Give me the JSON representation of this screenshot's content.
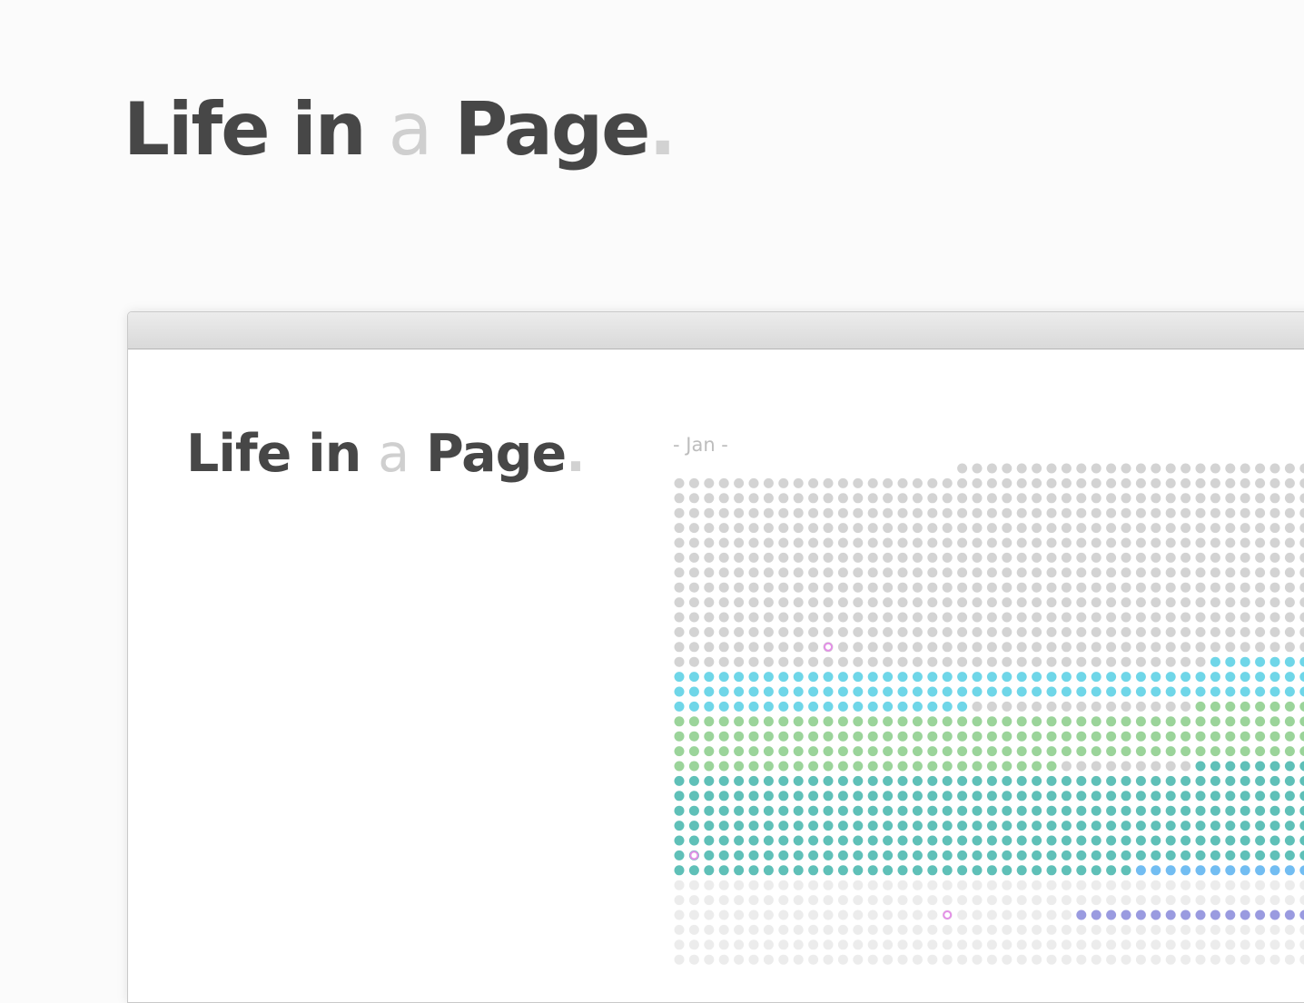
{
  "title": {
    "part1": "Life in",
    "part2": "a",
    "part3": "Page",
    "part4": "."
  },
  "app": {
    "month_label": "- Jan -"
  },
  "colors": {
    "text_dark": "#474747",
    "text_light": "#cfcfcf",
    "dot_gray": "#d3d3d3",
    "dot_lightgray": "#ececec",
    "dot_cyan": "#6fd6e8",
    "dot_green": "#9bd49a",
    "dot_teal": "#5fc0b8",
    "dot_blue": "#72bdf2",
    "dot_purple": "#9a9be0",
    "dot_pink": "#e38fe6"
  },
  "chart_data": {
    "type": "heatmap",
    "month": "Jan",
    "columns": 43,
    "rows": 34,
    "first_day_partial_columns": 19,
    "legend": {
      "g": "gray",
      "c": "cyan",
      "G": "green",
      "t": "teal",
      "b": "blue",
      "p": "purple",
      "l": "lightgray",
      "x": "none"
    },
    "cell_rows": [
      "xxxxxxxxxxxxxxxxxxxggggggggggggggggggggggggg",
      "ggggggggggggggggggggggggggggggggggggggggggg",
      "ggggggggggggggggggggggggggggggggggggggggggg",
      "ggggggggggggggggggggggggggggggggggggggggggg",
      "ggggggggggggggggggggggggggggggggggggggggggg",
      "ggggggggggggggggggggggggggggggggggggggggggg",
      "ggggggggggggggggggggggggggggggggggggggggggg",
      "ggggggggggggggggggggggggggggggggggggggggggg",
      "ggggggggggggggggggggggggggggggggggggggggggg",
      "ggggggggggggggggggggggggggggggggggggggggggg",
      "ggggggggggggggggggggggggggggggggggggggggggg",
      "ggggggggggggggggggggggggggggggggggggggggggg",
      "ggggggggggggggggggggggggggggggggggggggggggg",
      "ggggggggggggggggggggggggggggggggggggcccccccc",
      "ccccccccccccccccccccccccccccccccccccccccccc",
      "ccccccccccccccccccccccccccccccccccccccccccc",
      "ccccccccccccccccccccgggggggggggggggGGGGGGGGG",
      "GGGGGGGGGGGGGGGGGGGGGGGGGGGGGGGGGGGGGGGGGGG",
      "GGGGGGGGGGGGGGGGGGGGGGGGGGGGGGGGGGGGGGGGGGG",
      "GGGGGGGGGGGGGGGGGGGGGGGGGGGGGGGGGGGGGGGGGGG",
      "GGGGGGGGGGGGGGGGGGGGGGGGGGgggggggggtttttttttt",
      "ttttttttttttttttttttttttttttttttttttttttttt",
      "ttttttttttttttttttttttttttttttttttttttttttt",
      "ttttttttttttttttttttttttttttttttttttttttttt",
      "ttttttttttttttttttttttttttttttttttttttttttt",
      "ttttttttttttttttttttttttttttttttttttttttttt",
      "ttttttttttttttttttttttttttttttttttttttttttt",
      "tttttttttttttttttttttttttttttttbbbbbbbbbbbb",
      "lllllllllllllllllllllllllllllllllllllllllll",
      "lllllllllllllllllllllllllllllllllllllllllll",
      "lllllllllllllllllllllllllllpppppppppppppppp",
      "lllllllllllllllllllllllllllllllllllllllllll",
      "lllllllllllllllllllllllllllllllllllllllllll",
      "lllllllllllllllllllllllllllllllllllllllllll"
    ],
    "highlight_markers": [
      {
        "row": 12,
        "col": 10,
        "style": "ring",
        "color": "pink"
      },
      {
        "row": 26,
        "col": 1,
        "style": "ring",
        "color": "pink"
      },
      {
        "row": 30,
        "col": 18,
        "style": "ring",
        "color": "pink"
      }
    ]
  }
}
